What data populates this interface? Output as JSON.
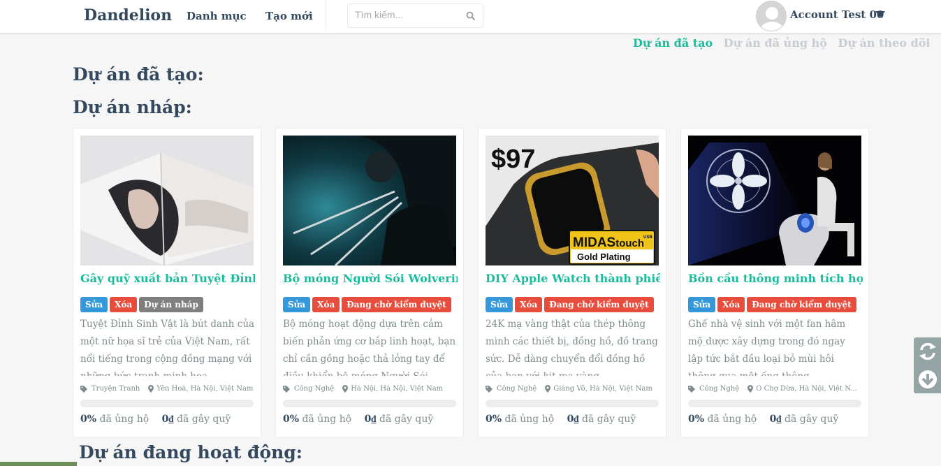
{
  "navbar": {
    "brand": "Dandelion",
    "menu": [
      "Danh mục",
      "Tạo mới"
    ],
    "search_placeholder": "Tìm kiếm...",
    "account_name": "Account Test 00"
  },
  "tabs": [
    "Dự án đã tạo",
    "Dự án đã ủng hộ",
    "Dự án theo dõi"
  ],
  "headings": {
    "created": "Dự án đã tạo:",
    "drafts": "Dự án nháp:",
    "active": "Dự án đang hoạt động:"
  },
  "projects": [
    {
      "title": "Gây quỹ xuất bản Tuyệt Đỉnh...",
      "edit_label": "Sửa",
      "delete_label": "Xóa",
      "status_label": "Dự án nháp",
      "description": "Tuyệt Đỉnh Sinh Vật là bút danh của một nữ họa sĩ trẻ của Việt Nam, rất nổi tiếng trong cộng đồng mạng với những bức tranh minh họa",
      "category": "Truyện Tranh",
      "location": "Yên Hoà, Hà Nội, Việt Nam",
      "funded_percent": "0%",
      "funded_label": "đã ủng hộ",
      "raised_amount": "0₫",
      "raised_label": "đã gây quỹ",
      "progress": 0
    },
    {
      "title": "Bộ móng Người Sói Wolverin...",
      "edit_label": "Sửa",
      "delete_label": "Xóa",
      "status_label": "Đang chờ kiểm duyệt",
      "description": "Bộ móng hoạt động dựa trên cảm biến phản ứng cơ bắp linh hoạt, bạn chỉ cần gồng hoặc thả lỏng tay để điều khiển bộ móng Người Sói",
      "category": "Công Nghệ",
      "location": "Hà Nội, Hà Nội, Việt Nam",
      "funded_percent": "0%",
      "funded_label": "đã ủng hộ",
      "raised_amount": "0₫",
      "raised_label": "đã gây quỹ",
      "progress": 0
    },
    {
      "title": "DIY Apple Watch thành phiê...",
      "edit_label": "Sửa",
      "delete_label": "Xóa",
      "status_label": "Đang chờ kiểm duyệt",
      "description": "24K mạ vàng thật của thép thông minh các thiết bị, đồng hồ, đồ trang sức. Dễ dàng chuyển đổi đồng hồ của bạn với kit mạ vàng",
      "category": "Công Nghệ",
      "location": "Giảng Võ, Hà Nội, Việt Nam",
      "funded_percent": "0%",
      "funded_label": "đã ủng hộ",
      "raised_amount": "0₫",
      "raised_label": "đã gây quỹ",
      "progress": 0,
      "image_text": {
        "price": "$97",
        "brand_a": "MIDAS",
        "brand_b": "touch",
        "brand_small": "USB",
        "plating": "Gold Plating"
      }
    },
    {
      "title": "Bồn cầu thông minh tích hợp ...",
      "edit_label": "Sửa",
      "delete_label": "Xóa",
      "status_label": "Đang chờ kiểm duyệt",
      "description": "Ghế nhà vệ sinh với một fan hâm mộ được xây dựng trong đó ngay lập tức bắt đầu loại bỏ mùi hôi thông qua một ống thông",
      "category": "Công Nghệ",
      "location": "Ô Chợ Dừa, Hà Nội, Việt N...",
      "funded_percent": "0%",
      "funded_label": "đã ủng hộ",
      "raised_amount": "0₫",
      "raised_label": "đã gây quỹ",
      "progress": 0
    }
  ]
}
